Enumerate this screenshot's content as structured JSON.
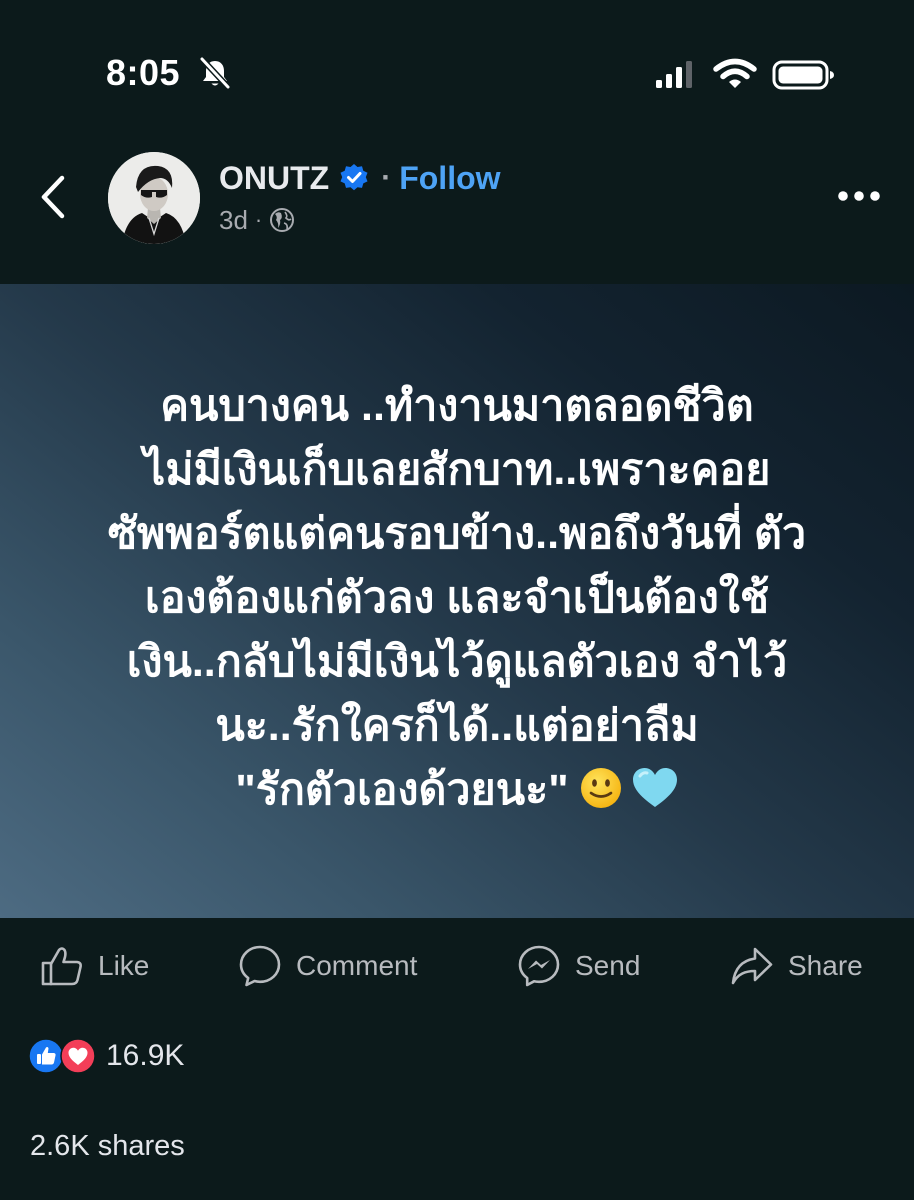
{
  "status_bar": {
    "time": "8:05",
    "icons": [
      "bell-slash-icon",
      "cellular-signal-icon",
      "wifi-icon",
      "battery-icon"
    ]
  },
  "post": {
    "author": "ONUTZ",
    "verified": true,
    "follow_label": "Follow",
    "separator": "·",
    "timestamp": "3d",
    "audience_icon": "globe-icon",
    "text": "คนบางคน ..ทำงานมาตลอดชีวิต\nไม่มีเงินเก็บเลยสักบาท..เพราะคอย\nซัพพอร์ตแต่คนรอบข้าง..พอถึงวันที่ ตัว\nเองต้องแก่ตัวลง และจำเป็นต้องใช้\nเงิน..กลับไม่มีเงินไว้ดูแลตัวเอง จำไว้\nนะ..รักใครก็ได้..แต่อย่าลืม\n\"รักตัวเองด้วยนะ\"",
    "trailing_emojis": [
      "slightly-smiling-face",
      "light-blue-heart"
    ]
  },
  "actions": {
    "like": "Like",
    "comment": "Comment",
    "send": "Send",
    "share": "Share"
  },
  "engagement": {
    "reaction_count": "16.9K",
    "shares": "2.6K shares"
  },
  "colors": {
    "background": "#0c1a1b",
    "accent": "#4ea3f5",
    "verified_badge": "#1877f2",
    "like_reaction": "#1877f2",
    "love_reaction": "#f33e58",
    "heart_emoji": "#7fd8f0"
  }
}
